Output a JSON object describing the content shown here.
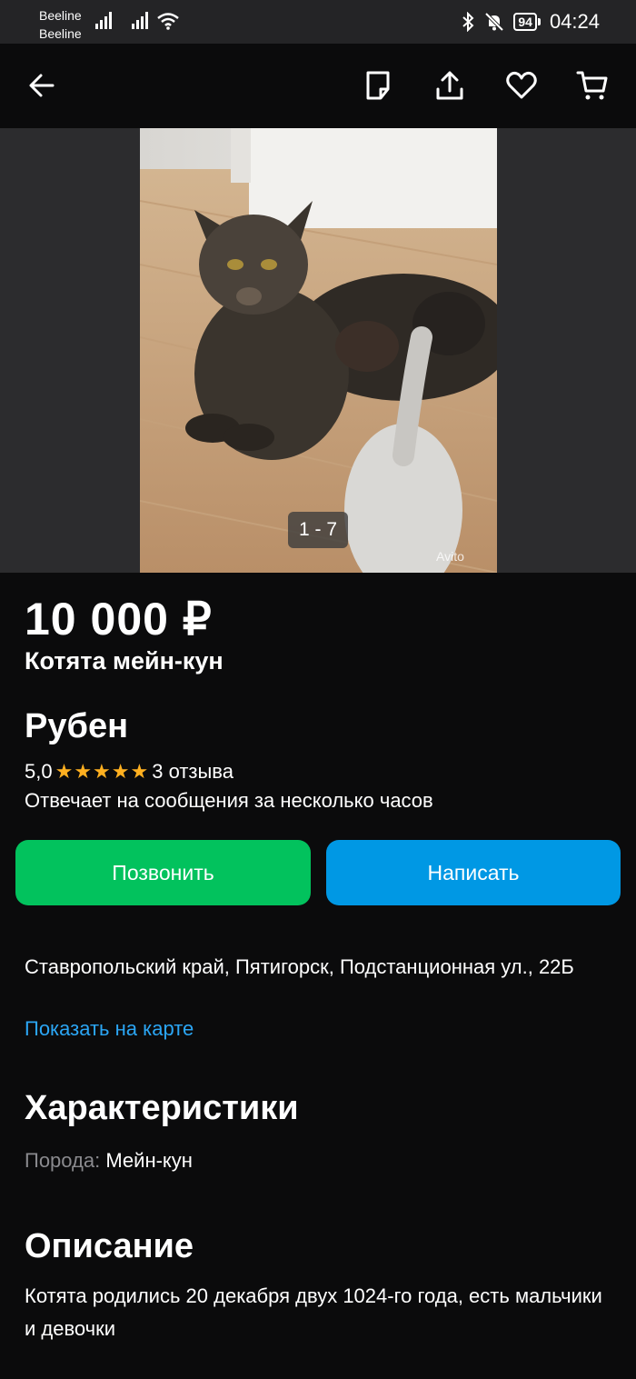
{
  "status_bar": {
    "carrier_1": "Beeline",
    "carrier_2": "Beeline",
    "battery": "94",
    "time": "04:24"
  },
  "nav": {
    "back_icon": "arrow-left-icon",
    "note_icon": "note-icon",
    "share_icon": "share-icon",
    "favorite_icon": "heart-icon",
    "cart_icon": "cart-icon"
  },
  "gallery": {
    "counter": "1 - 7",
    "watermark": "Avito"
  },
  "listing": {
    "price": "10 000 ₽",
    "title": "Котята мейн-кун"
  },
  "seller": {
    "name": "Рубен",
    "rating": "5,0",
    "stars": "★★★★★",
    "reviews": "3 отзыва",
    "reply_time": "Отвечает на сообщения за несколько часов"
  },
  "actions": {
    "call": "Позвонить",
    "write": "Написать"
  },
  "location": {
    "address": "Ставропольский край, Пятигорск, Подстанционная ул., 22Б",
    "map_link": "Показать на карте"
  },
  "characteristics": {
    "heading": "Характеристики",
    "breed_label": "Порода:",
    "breed_value": "Мейн-кун"
  },
  "description": {
    "heading": "Описание",
    "text": "Котята родились 20 декабря двух 1024-го года, есть мальчики и девочки"
  },
  "colors": {
    "call_button": "#02c25d",
    "write_button": "#0098e4",
    "link": "#2ba6f5",
    "stars": "#ffb020"
  }
}
